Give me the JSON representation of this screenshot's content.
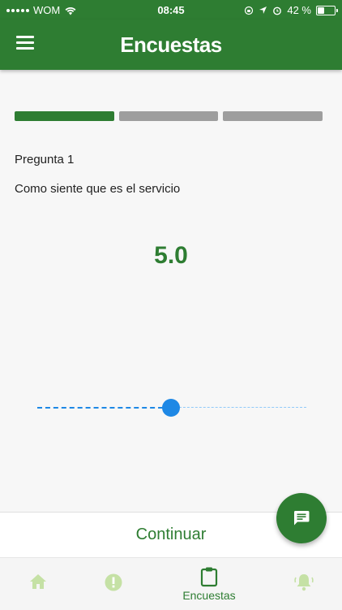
{
  "status_bar": {
    "carrier": "WOM",
    "time": "08:45",
    "battery_percent": "42 %",
    "battery_level": 0.42
  },
  "app_bar": {
    "title": "Encuestas"
  },
  "survey": {
    "progress": {
      "total_steps": 3,
      "current_step": 1
    },
    "question_number": "Pregunta 1",
    "question_text": "Como siente que es el servicio",
    "rating_display": "5.0",
    "slider": {
      "min": 0,
      "max": 10,
      "value": 5
    }
  },
  "actions": {
    "continue_label": "Continuar"
  },
  "bottom_nav": {
    "items": [
      {
        "icon": "home-icon",
        "label": ""
      },
      {
        "icon": "alert-icon",
        "label": ""
      },
      {
        "icon": "clipboard-icon",
        "label": "Encuestas",
        "active": true
      },
      {
        "icon": "bell-icon",
        "label": ""
      }
    ]
  },
  "colors": {
    "primary": "#2e7d32",
    "slider": "#1e88e5",
    "inactive_nav_icon": "#c5e1a5",
    "progress_inactive": "#9e9e9e"
  }
}
